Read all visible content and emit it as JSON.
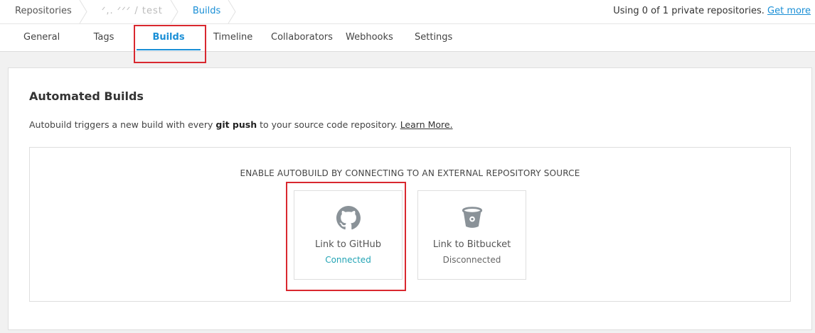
{
  "breadcrumb": {
    "items": [
      {
        "label": "Repositories"
      },
      {
        "label": "ᐟ,.  ᐟᐟᐟ / test"
      },
      {
        "label": "Builds"
      }
    ]
  },
  "repo_usage": {
    "text": "Using 0 of 1 private repositories.",
    "link": "Get more"
  },
  "tabs": [
    {
      "label": "General"
    },
    {
      "label": "Tags"
    },
    {
      "label": "Builds"
    },
    {
      "label": "Timeline"
    },
    {
      "label": "Collaborators"
    },
    {
      "label": "Webhooks"
    },
    {
      "label": "Settings"
    }
  ],
  "active_tab": "Builds",
  "automated_builds": {
    "title": "Automated Builds",
    "desc_prefix": "Autobuild triggers a new build with every ",
    "desc_bold": "git push",
    "desc_suffix": " to your source code repository. ",
    "learn_more": "Learn More.",
    "source_heading": "ENABLE AUTOBUILD BY CONNECTING TO AN EXTERNAL REPOSITORY SOURCE",
    "sources": [
      {
        "label": "Link to GitHub",
        "status": "Connected",
        "icon": "github-icon"
      },
      {
        "label": "Link to Bitbucket",
        "status": "Disconnected",
        "icon": "bitbucket-icon"
      }
    ]
  },
  "colors": {
    "accent": "#1a8fd6",
    "connected": "#23a4b5",
    "highlight": "#d9282f",
    "icon": "#8a9298"
  }
}
